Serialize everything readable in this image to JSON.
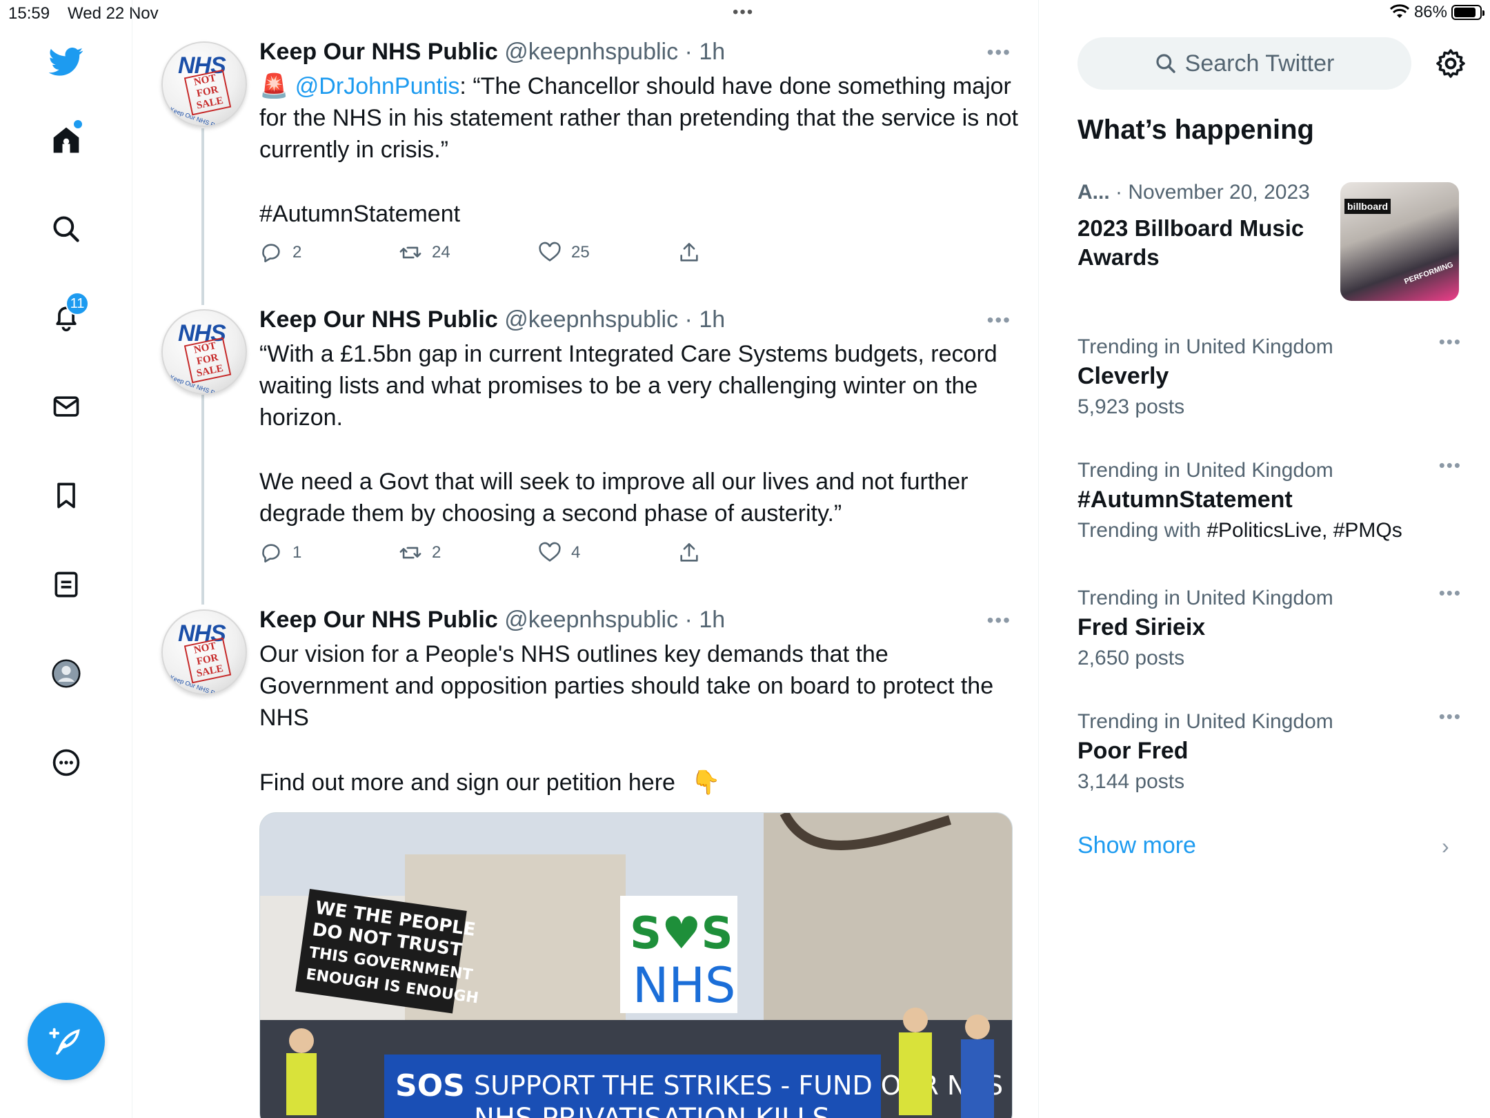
{
  "status_bar": {
    "time": "15:59",
    "date": "Wed 22 Nov",
    "battery": "86%",
    "battery_level": 0.86
  },
  "nav": {
    "items": [
      {
        "name": "home",
        "icon": "home-icon",
        "has_dot": true
      },
      {
        "name": "explore",
        "icon": "search-icon"
      },
      {
        "name": "notifications",
        "icon": "bell-icon",
        "badge": "11"
      },
      {
        "name": "messages",
        "icon": "mail-icon"
      },
      {
        "name": "bookmarks",
        "icon": "bookmark-icon"
      },
      {
        "name": "lists",
        "icon": "list-icon"
      },
      {
        "name": "profile",
        "icon": "avatar-icon"
      },
      {
        "name": "more",
        "icon": "more-circle-icon"
      }
    ],
    "compose_icon": "feather-plus-icon"
  },
  "colors": {
    "accent": "#1d9bf0",
    "text_primary": "#0f1419",
    "text_secondary": "#536471",
    "border": "#eff3f4"
  },
  "tweets": [
    {
      "author": "Keep Our NHS Public",
      "handle": "@keepnhspublic",
      "time": "· 1h",
      "alert_emoji": "🚨",
      "mention": "@DrJohnPuntis",
      "text": ": “The Chancellor should have done something major for the NHS in his statement rather than pretending that the service is not currently in crisis.”",
      "hashtag": "#AutumnStatement",
      "replies": "2",
      "retweets": "24",
      "likes": "25"
    },
    {
      "author": "Keep Our NHS Public",
      "handle": "@keepnhspublic",
      "time": "· 1h",
      "para1": "“With a £1.5bn gap in current Integrated Care Systems budgets, record waiting lists and what promises to be a very challenging winter on the horizon.",
      "para2": "We need a Govt that will seek to improve all our lives and not further degrade them by choosing a second phase of austerity.”",
      "replies": "1",
      "retweets": "2",
      "likes": "4"
    },
    {
      "author": "Keep Our NHS Public",
      "handle": "@keepnhspublic",
      "time": "· 1h",
      "para1": "Our vision for a People's NHS outlines key demands that the Government and opposition parties should take on board to protect the NHS",
      "para2": "Find out more and sign our petition here",
      "emoji": "👇",
      "image_banners": [
        "WE THE PEOPLE DO NOT TRUST THIS GOVERNMENT ENOUGH IS ENOUGH",
        "SOS NHS",
        "SUPPORT THE STRIKES - FUND OUR NHS",
        "NHS PRIVATISATION KILLS"
      ]
    }
  ],
  "avatar_text": {
    "line1": "NHS",
    "stamp": "NOT FOR SALE",
    "ring": "Keep Our NHS Public"
  },
  "sidebar": {
    "search_placeholder": "Search Twitter",
    "heading": "What’s happening",
    "event": {
      "category": "A...",
      "date": "· November 20, 2023",
      "title": "2023 Billboard Music Awards",
      "thumb_brand": "billboard",
      "thumb_caption": "PERFORMING"
    },
    "trends": [
      {
        "context": "Trending in United Kingdom",
        "title": "Cleverly",
        "sub": "5,923 posts"
      },
      {
        "context": "Trending in United Kingdom",
        "title": "#AutumnStatement",
        "sub_prefix": "Trending with ",
        "sub_tags": "#PoliticsLive, #PMQs"
      },
      {
        "context": "Trending in United Kingdom",
        "title": "Fred Sirieix",
        "sub": "2,650 posts"
      },
      {
        "context": "Trending in United Kingdom",
        "title": "Poor Fred",
        "sub": "3,144 posts"
      }
    ],
    "show_more": "Show more"
  }
}
